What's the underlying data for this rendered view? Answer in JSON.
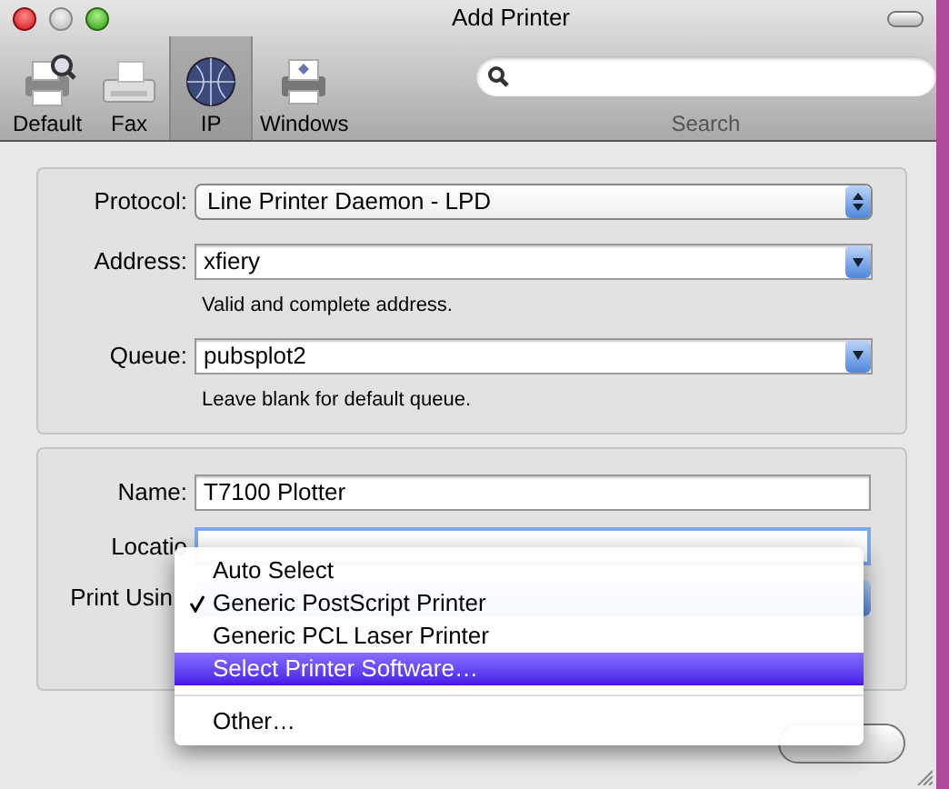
{
  "window": {
    "title": "Add Printer"
  },
  "toolbar": {
    "items": [
      {
        "label": "Default",
        "kind": "default",
        "selected": false
      },
      {
        "label": "Fax",
        "kind": "fax",
        "selected": false
      },
      {
        "label": "IP",
        "kind": "ip",
        "selected": true
      },
      {
        "label": "Windows",
        "kind": "windows",
        "selected": false
      }
    ]
  },
  "search": {
    "label": "Search"
  },
  "connection": {
    "protocol": {
      "label": "Protocol:",
      "value": "Line Printer Daemon - LPD"
    },
    "address": {
      "label": "Address:",
      "value": "xfiery",
      "hint": "Valid and complete address."
    },
    "queue": {
      "label": "Queue:",
      "value": "pubsplot2",
      "hint": "Leave blank for default queue."
    }
  },
  "printer": {
    "name": {
      "label": "Name:",
      "value": "T7100 Plotter"
    },
    "location": {
      "label": "Locatio"
    },
    "print_using": {
      "label": "Print Usin"
    }
  },
  "menu": {
    "items": [
      {
        "label": "Auto Select",
        "checked": false,
        "selected": false,
        "separator_before": false
      },
      {
        "label": "Generic PostScript Printer",
        "checked": true,
        "selected": false,
        "separator_before": false
      },
      {
        "label": "Generic PCL Laser Printer",
        "checked": false,
        "selected": false,
        "separator_before": false
      },
      {
        "label": "Select Printer Software…",
        "checked": false,
        "selected": true,
        "separator_before": false
      },
      {
        "label": "Other…",
        "checked": false,
        "selected": false,
        "separator_before": true
      }
    ]
  }
}
